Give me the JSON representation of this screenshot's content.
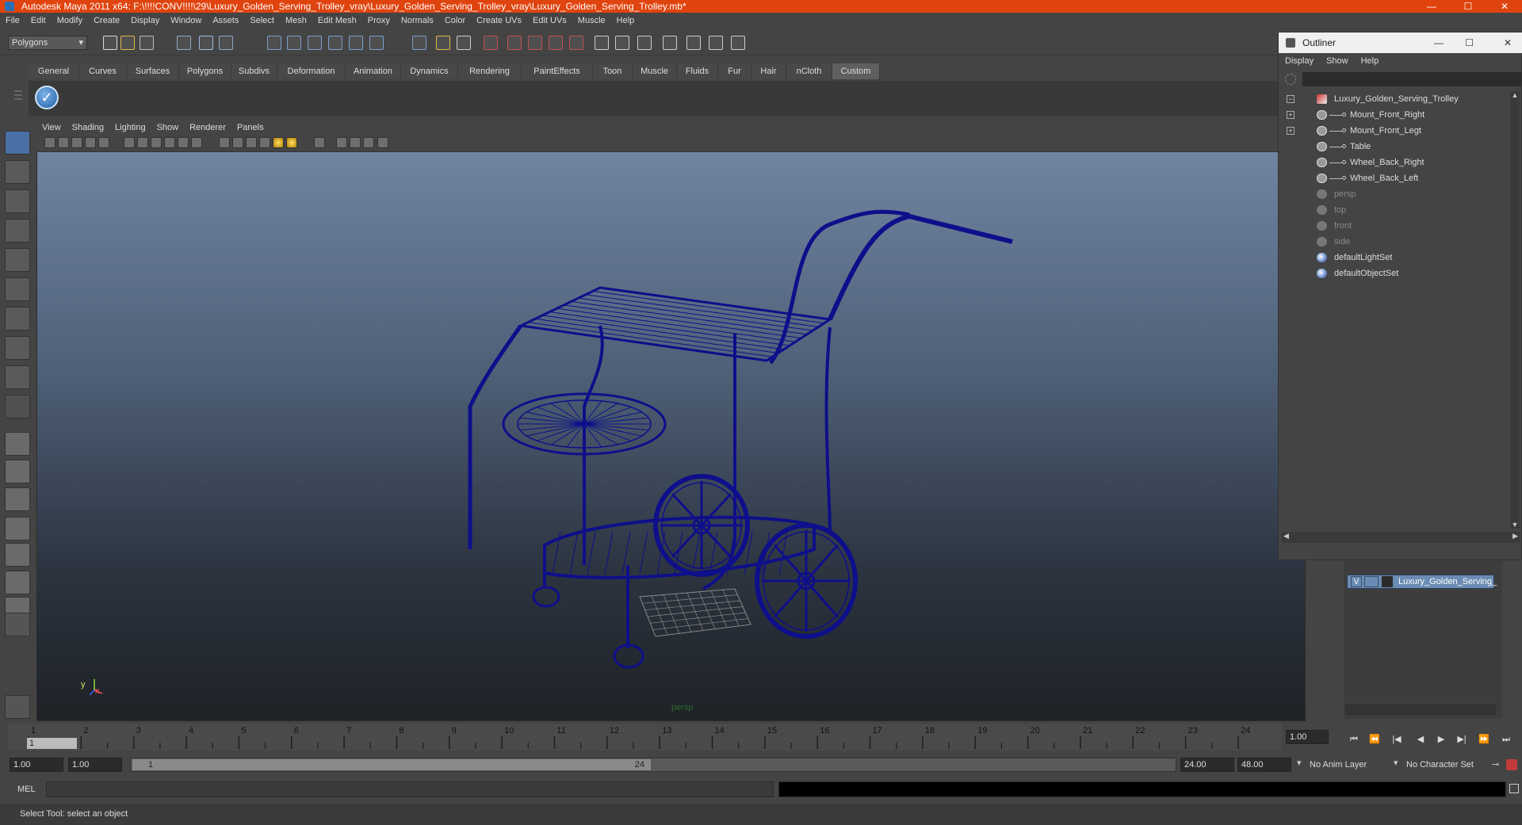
{
  "window": {
    "title": "Autodesk Maya 2011 x64: F:\\!!!!CONV!!!!\\29\\Luxury_Golden_Serving_Trolley_vray\\Luxury_Golden_Serving_Trolley_vray\\Luxury_Golden_Serving_Trolley.mb*",
    "minimize": "—",
    "maximize": "☐",
    "close": "✕"
  },
  "menubar": [
    "File",
    "Edit",
    "Modify",
    "Create",
    "Display",
    "Window",
    "Assets",
    "Select",
    "Mesh",
    "Edit Mesh",
    "Proxy",
    "Normals",
    "Color",
    "Create UVs",
    "Edit UVs",
    "Muscle",
    "Help"
  ],
  "statusline": {
    "mode": "Polygons"
  },
  "shelf": {
    "tabs": [
      "General",
      "Curves",
      "Surfaces",
      "Polygons",
      "Subdivs",
      "Deformation",
      "Animation",
      "Dynamics",
      "Rendering",
      "PaintEffects",
      "Toon",
      "Muscle",
      "Fluids",
      "Fur",
      "Hair",
      "nCloth",
      "Custom"
    ],
    "active": "Custom"
  },
  "viewport": {
    "menu": [
      "View",
      "Shading",
      "Lighting",
      "Show",
      "Renderer",
      "Panels"
    ],
    "camera_label": "persp",
    "axis_y": "y",
    "axis_x": "x",
    "wire_color": "#0e0f8a"
  },
  "outliner": {
    "title": "Outliner",
    "menu": [
      "Display",
      "Show",
      "Help"
    ],
    "items": [
      {
        "label": "Luxury_Golden_Serving_Trolley",
        "kind": "group",
        "expanded": true
      },
      {
        "label": "Mount_Front_Right",
        "kind": "child"
      },
      {
        "label": "Mount_Front_Legt",
        "kind": "child"
      },
      {
        "label": "Table",
        "kind": "child"
      },
      {
        "label": "Wheel_Back_Right",
        "kind": "child"
      },
      {
        "label": "Wheel_Back_Left",
        "kind": "child"
      },
      {
        "label": "persp",
        "kind": "camera"
      },
      {
        "label": "top",
        "kind": "camera"
      },
      {
        "label": "front",
        "kind": "camera"
      },
      {
        "label": "side",
        "kind": "camera"
      },
      {
        "label": "defaultLightSet",
        "kind": "set"
      },
      {
        "label": "defaultObjectSet",
        "kind": "set"
      }
    ]
  },
  "layers": {
    "rows": [
      {
        "visible": "V",
        "name": "Luxury_Golden_Serving_"
      }
    ]
  },
  "timeline": {
    "ticks": [
      "1",
      "2",
      "3",
      "4",
      "5",
      "6",
      "7",
      "8",
      "9",
      "10",
      "11",
      "12",
      "13",
      "14",
      "15",
      "16",
      "17",
      "18",
      "19",
      "20",
      "21",
      "22",
      "23",
      "24"
    ],
    "current_frame": "1",
    "current_time": "1.00"
  },
  "range": {
    "start_time": "1.00",
    "playback_start": "1.00",
    "slider_start": "1",
    "slider_end": "24",
    "playback_end": "24.00",
    "end_time": "48.00",
    "anim_layer": "No Anim Layer",
    "character_set": "No Character Set"
  },
  "command": {
    "label": "MEL"
  },
  "help_line": "Select Tool: select an object"
}
